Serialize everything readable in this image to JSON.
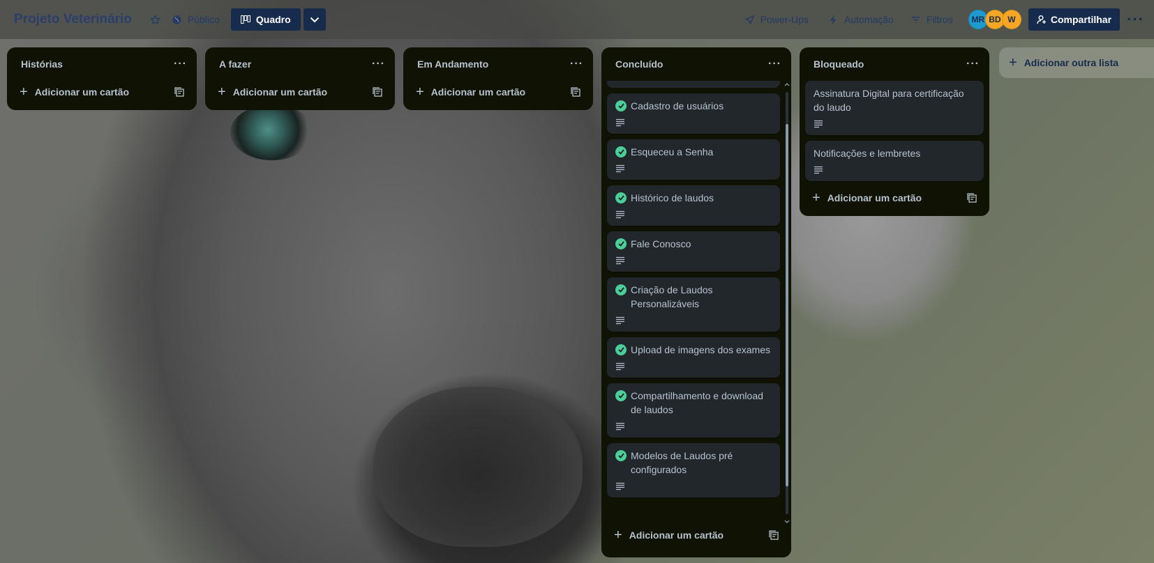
{
  "header": {
    "board_title": "Projeto Veterinário",
    "visibility_label": "Público",
    "view_label": "Quadro",
    "powerups_label": "Power-Ups",
    "automation_label": "Automação",
    "filters_label": "Filtros",
    "share_label": "Compartilhar",
    "avatars": [
      {
        "initials": "MR",
        "color": "#1d9bd1"
      },
      {
        "initials": "BD",
        "color": "#f5a623"
      },
      {
        "initials": "W",
        "color": "#f5a623"
      }
    ]
  },
  "lists": [
    {
      "title": "Histórias",
      "add_label": "Adicionar um cartão",
      "cards": []
    },
    {
      "title": "A fazer",
      "add_label": "Adicionar um cartão",
      "cards": []
    },
    {
      "title": "Em Andamento",
      "add_label": "Adicionar um cartão",
      "cards": []
    },
    {
      "title": "Concluído",
      "add_label": "Adicionar um cartão",
      "cards": [
        {
          "title": "Cadastro de usuários"
        },
        {
          "title": "Esqueceu a Senha"
        },
        {
          "title": "Histórico de laudos"
        },
        {
          "title": "Fale Conosco"
        },
        {
          "title": "Criação de Laudos Personalizáveis"
        },
        {
          "title": "Upload de imagens dos exames"
        },
        {
          "title": "Compartilhamento e download de laudos"
        },
        {
          "title": "Modelos de Laudos pré configurados"
        }
      ]
    },
    {
      "title": "Bloqueado",
      "add_label": "Adicionar um cartão",
      "cards": [
        {
          "title": "Assinatura Digital para certificação do laudo"
        },
        {
          "title": "Notificações e lembretes"
        }
      ]
    }
  ],
  "add_list_label": "Adicionar outra lista"
}
